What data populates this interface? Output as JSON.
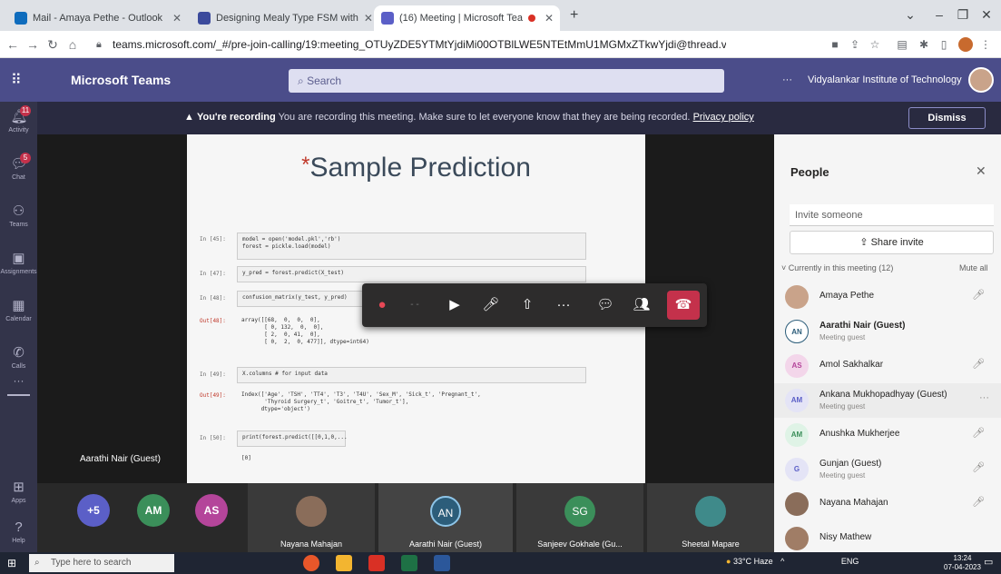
{
  "browser": {
    "tabs": [
      {
        "label": "Mail - Amaya Pethe - Outlook",
        "color": "#0f6cbd"
      },
      {
        "label": "Designing Mealy Type FSM with",
        "color": "#3b4a9c"
      },
      {
        "label": "(16) Meeting | Microsoft Tea",
        "color": "#5b5fc7"
      }
    ],
    "new_tab": "+",
    "url": "teams.microsoft.com/_#/pre-join-calling/19:meeting_OTUyZDE5YTMtYjdiMi00OTBlLWE5NTEtMmU1MGMxZTkwYjdi@thread.v2"
  },
  "teams": {
    "app_name": "Microsoft Teams",
    "search_placeholder": "Search",
    "more": "···",
    "org": "Vidyalankar Institute of Technology"
  },
  "rail": {
    "items": [
      {
        "label": "Activity",
        "icon": "bell-icon",
        "badge": "11"
      },
      {
        "label": "Chat",
        "icon": "chat-icon",
        "badge": "5"
      },
      {
        "label": "Teams",
        "icon": "teams-icon",
        "badge": ""
      },
      {
        "label": "Assignments",
        "icon": "assignments-icon",
        "badge": ""
      },
      {
        "label": "Calendar",
        "icon": "calendar-icon",
        "badge": ""
      },
      {
        "label": "Calls",
        "icon": "phone-icon",
        "badge": ""
      },
      {
        "label": "···",
        "icon": "more-icon",
        "badge": ""
      }
    ],
    "apps_label": "Apps",
    "help_label": "Help"
  },
  "banner": {
    "bold": "You're recording",
    "text": "You are recording this meeting. Make sure to let everyone know that they are being recorded.",
    "link": "Privacy policy",
    "dismiss": "Dismiss"
  },
  "slide": {
    "star": "*",
    "title": "Sample Prediction",
    "cells": [
      {
        "prompt": "In [45]:",
        "code": "model = open('model.pkl','rb')\nforest = pickle.load(model)"
      },
      {
        "prompt": "In [47]:",
        "code": "y_pred = forest.predict(X_test)"
      },
      {
        "prompt": "In [48]:",
        "code": "confusion_matrix(y_test, y_pred)"
      },
      {
        "prompt": "Out[48]:",
        "code": "array([[68,  0,  0,  0],\n       [ 0, 132,  0,  0],\n       [ 2,  0, 41,  0],\n       [ 0,  2,  0, 477]], dtype=int64)"
      },
      {
        "prompt": "In [49]:",
        "code": "X.columns # for input data"
      },
      {
        "prompt": "Out[49]:",
        "code": "Index(['Age', 'TSH', 'TT4', 'T3', 'T4U', 'Sex_M', 'Sick_t', 'Pregnant_t',\n       'Thyroid Surgery_t', 'Goitre_t', 'Tumor_t'],\n      dtype='object')"
      },
      {
        "prompt": "In [50]:",
        "code": "print(forest.predict([[0,1,0,..."
      },
      {
        "prompt": "",
        "code": "[0]"
      }
    ]
  },
  "presenter": "Aarathi Nair (Guest)",
  "strip": {
    "bubbles": [
      {
        "text": "+5",
        "color": "#5b5fc7"
      },
      {
        "text": "AM",
        "color": "#3b8f5a"
      },
      {
        "text": "AS",
        "color": "#b4459a"
      }
    ],
    "tiles": [
      {
        "name": "Nayana Mahajan",
        "avatar": "",
        "color": "#8a6d5a"
      },
      {
        "name": "Aarathi Nair (Guest)",
        "avatar": "AN",
        "color": "#2c5d7a"
      },
      {
        "name": "Sanjeev Gokhale (Gu...",
        "avatar": "SG",
        "color": "#3b8f5a"
      },
      {
        "name": "Sheetal Mapare",
        "avatar": "",
        "color": "#3f8a8a"
      }
    ]
  },
  "people": {
    "title": "People",
    "invite_placeholder": "Invite someone",
    "share": "Share invite",
    "section": "Currently in this meeting (12)",
    "mute_all": "Mute all",
    "list": [
      {
        "name": "Amaya Pethe",
        "sub": "",
        "initials": "",
        "bg": "#c9a38a",
        "fg": "#fff"
      },
      {
        "name": "Aarathi Nair (Guest)",
        "sub": "Meeting guest",
        "initials": "AN",
        "bg": "#fff",
        "fg": "#2c5d7a"
      },
      {
        "name": "Amol Sakhalkar",
        "sub": "",
        "initials": "AS",
        "bg": "#f3d6ea",
        "fg": "#b4459a"
      },
      {
        "name": "Ankana Mukhopadhyay (Guest)",
        "sub": "Meeting guest",
        "initials": "AM",
        "bg": "#e4e4f6",
        "fg": "#5b5fc7"
      },
      {
        "name": "Anushka Mukherjee",
        "sub": "",
        "initials": "AM",
        "bg": "#dff3e6",
        "fg": "#3b8f5a"
      },
      {
        "name": "Gunjan (Guest)",
        "sub": "Meeting guest",
        "initials": "G",
        "bg": "#e4e4f6",
        "fg": "#5b5fc7"
      },
      {
        "name": "Nayana Mahajan",
        "sub": "",
        "initials": "",
        "bg": "#8a6d5a",
        "fg": "#fff"
      },
      {
        "name": "Nisy Mathew",
        "sub": "",
        "initials": "",
        "bg": "#a07d66",
        "fg": "#fff"
      }
    ]
  },
  "taskbar": {
    "search_placeholder": "Type here to search",
    "weather": "33°C Haze",
    "lang": "ENG",
    "time": "13:24",
    "date": "07-04-2023"
  }
}
